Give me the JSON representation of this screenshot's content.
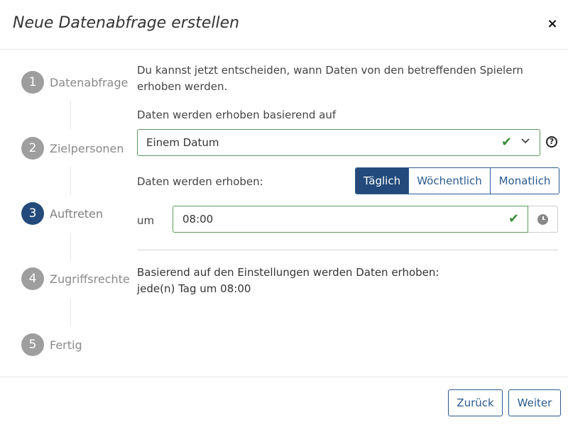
{
  "dialog": {
    "title": "Neue Datenabfrage erstellen",
    "close_label": "×"
  },
  "steps": [
    {
      "number": "1",
      "label": "Datenabfrage",
      "active": false
    },
    {
      "number": "2",
      "label": "Zielpersonen",
      "active": false
    },
    {
      "number": "3",
      "label": "Auftreten",
      "active": true
    },
    {
      "number": "4",
      "label": "Zugriffsrechte",
      "active": false
    },
    {
      "number": "5",
      "label": "Fertig",
      "active": false
    }
  ],
  "content": {
    "intro": "Du kannst jetzt entscheiden, wann Daten von den betreffenden Spielern erhoben werden.",
    "basis_label": "Daten werden erhoben basierend auf",
    "basis_value": "Einem Datum",
    "help_symbol": "?",
    "frequency_label": "Daten werden erhoben:",
    "frequency_options": [
      "Täglich",
      "Wöchentlich",
      "Monatlich"
    ],
    "frequency_selected": "Täglich",
    "time_label": "um",
    "time_value": "08:00",
    "summary_line1": "Basierend auf den Einstellungen werden Daten erhoben:",
    "summary_line2": "jede(n) Tag um 08:00"
  },
  "footer": {
    "back_label": "Zurück",
    "next_label": "Weiter"
  },
  "colors": {
    "primary": "#234a7a",
    "valid": "#3c8c3c",
    "step_inactive": "#9e9e9e"
  }
}
